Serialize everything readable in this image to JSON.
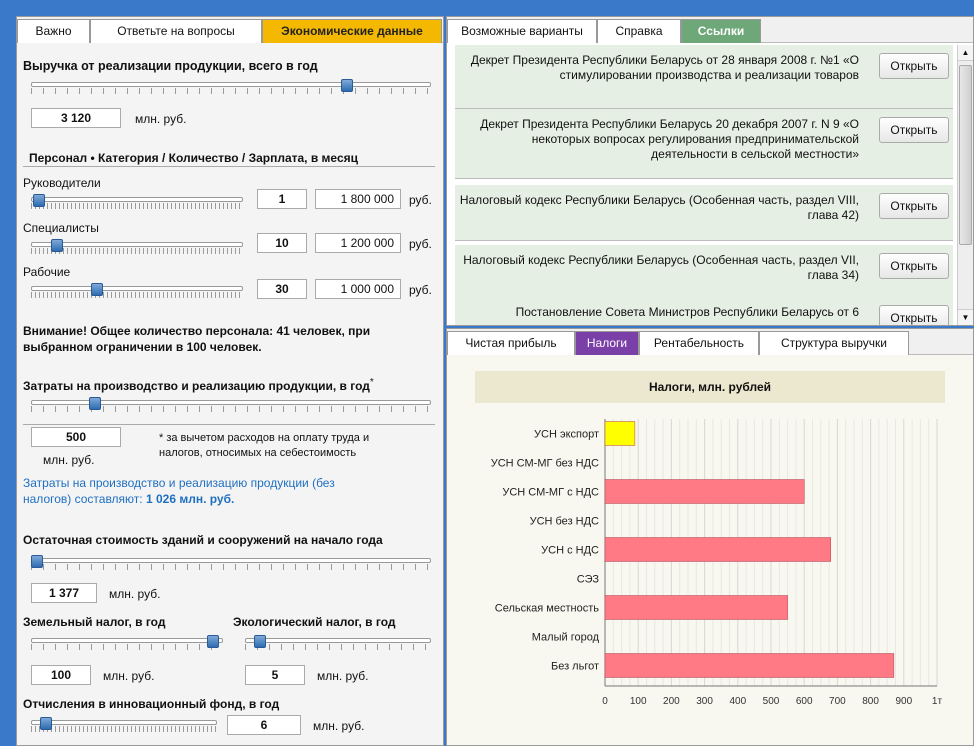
{
  "left_tabs": [
    "Важно",
    "Ответьте на вопросы",
    "Экономические данные"
  ],
  "revenue": {
    "title": "Выручка от реализации продукции, всего в год",
    "value": "3 120",
    "unit": "млн. руб.",
    "slider": 0.8
  },
  "personnel": {
    "title": "Персонал • Категория / Количество / Зарплата, в месяц",
    "rows": [
      {
        "label": "Руководители",
        "count": "1",
        "salary": "1 800 000",
        "unit": "руб.",
        "slider": 0.01
      },
      {
        "label": "Специалисты",
        "count": "10",
        "salary": "1 200 000",
        "unit": "руб.",
        "slider": 0.1
      },
      {
        "label": "Рабочие",
        "count": "30",
        "salary": "1 000 000",
        "unit": "руб.",
        "slider": 0.3
      }
    ],
    "warning": "Внимание! Общее количество персонала: 41 человек, при выбранном ограничении в 100 человек."
  },
  "costs": {
    "title": "Затраты на производство и реализацию продукции, в год",
    "asterisk": "*",
    "value": "500",
    "unit": "млн. руб.",
    "note": "* за вычетом расходов на оплату труда и налогов, относимых на себестоимость",
    "total_text": "Затраты на производство и реализацию продукции (без налогов) составляют:",
    "total_value": "1 026 млн. руб.",
    "slider": 0.15
  },
  "buildings": {
    "title": "Остаточная стоимость зданий и сооружений на начало года",
    "value": "1 377",
    "unit": "млн. руб.",
    "slider": 0.0
  },
  "land": {
    "title": "Земельный налог, в год",
    "value": "100",
    "unit": "млн. руб.",
    "slider": 0.98
  },
  "eco": {
    "title": "Экологический налог, в год",
    "value": "5",
    "unit": "млн. руб.",
    "slider": 0.05
  },
  "innov": {
    "title": "Отчисления в инновационный фонд, в год",
    "value": "6",
    "unit": "млн. руб.",
    "slider": 0.05
  },
  "right_tabs": [
    "Возможные варианты",
    "Справка",
    "Ссылки"
  ],
  "links": [
    {
      "text": "Декрет Президента Республики Беларусь от 28 января 2008 г. №1 «О стимулировании производства и реализации товаров",
      "btn": "Открыть"
    },
    {
      "text": "Декрет Президента Республики Беларусь 20 декабря 2007 г. N 9 «О некоторых вопросах регулирования предпринимательской деятельности в сельской местности»",
      "btn": "Открыть"
    },
    {
      "text": "Налоговый кодекс Республики Беларусь (Особенная часть, раздел VIII, глава 42)",
      "btn": "Открыть"
    },
    {
      "text": "Налоговый кодекс Республики Беларусь (Особенная часть, раздел VII, глава 34)",
      "btn": "Открыть"
    },
    {
      "text": "Постановление Совета Министров Республики Беларусь от 6",
      "btn": "Открыть"
    }
  ],
  "chart_tabs": [
    "Чистая прибыль",
    "Налоги",
    "Рентабельность",
    "Структура выручки"
  ],
  "colors": {
    "accent_tab": "#f5b800",
    "link_tab": "#6fa878",
    "chart_tab": "#7b3fa8",
    "bar_red": "#ff7a85",
    "bar_yellow": "#ffff00"
  },
  "chart_data": {
    "type": "bar",
    "orientation": "horizontal",
    "title": "Налоги, млн. рублей",
    "categories": [
      "УСН экспорт",
      "УСН СМ-МГ без НДС",
      "УСН СМ-МГ с НДС",
      "УСН без НДС",
      "УСН с НДС",
      "СЭЗ",
      "Сельская местность",
      "Малый город",
      "Без льгот"
    ],
    "values": [
      90,
      0,
      600,
      0,
      680,
      0,
      550,
      0,
      870
    ],
    "colors": [
      "#ffff00",
      "#ff7a85",
      "#ff7a85",
      "#ff7a85",
      "#ff7a85",
      "#ff7a85",
      "#ff7a85",
      "#ff7a85",
      "#ff7a85"
    ],
    "xticks": [
      "0",
      "100",
      "200",
      "300",
      "400",
      "500",
      "600",
      "700",
      "800",
      "900",
      "1т"
    ],
    "xlim": [
      0,
      1000
    ],
    "grid": true
  }
}
